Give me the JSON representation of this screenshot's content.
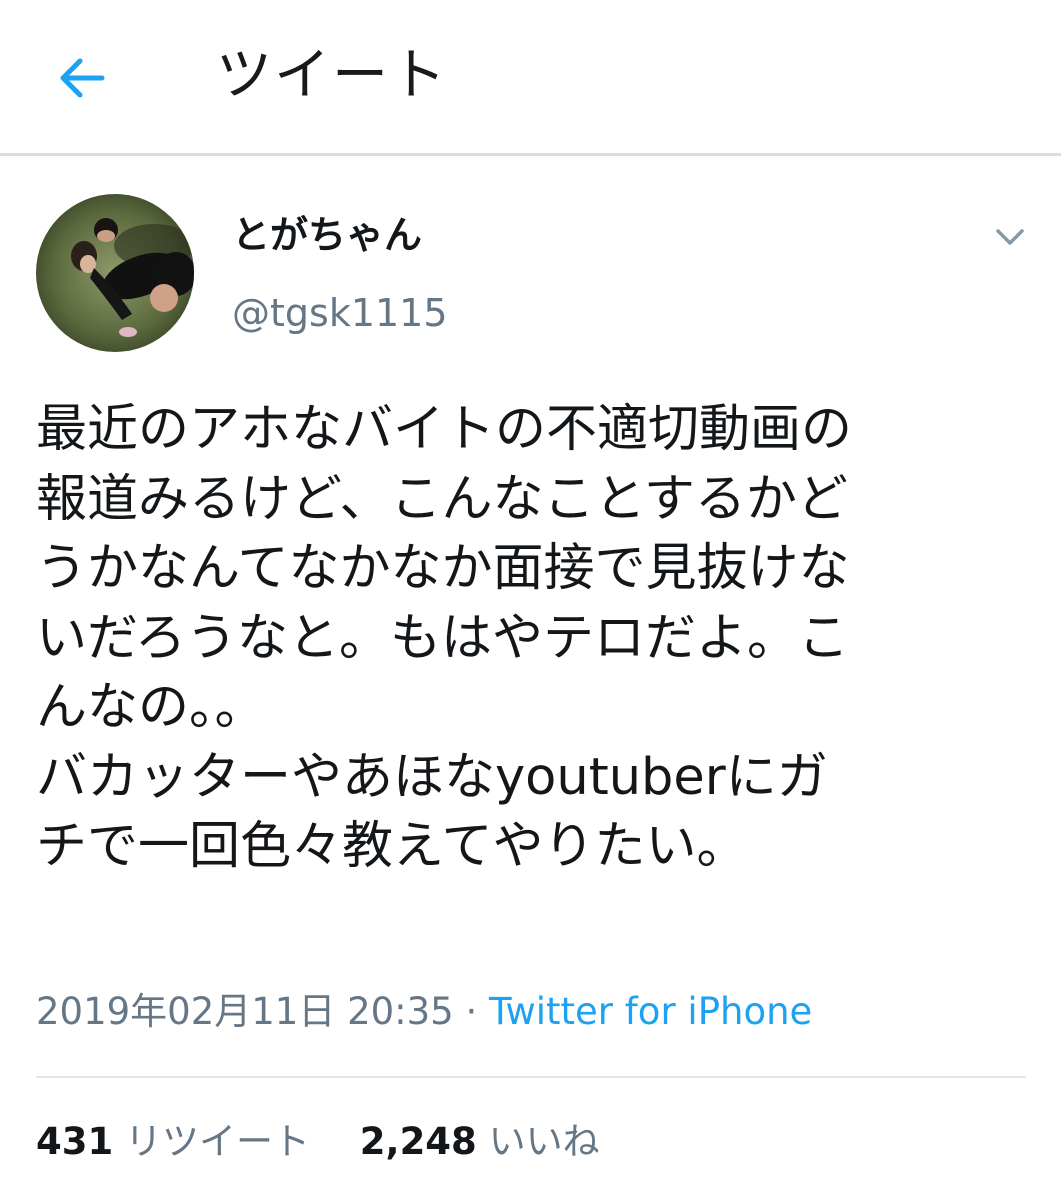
{
  "header": {
    "title": "ツイート",
    "back_icon": "arrow-left-icon"
  },
  "tweet": {
    "author": {
      "display_name": "とがちゃん",
      "handle": "@tgsk1115"
    },
    "text": "最近のアホなバイトの不適切動画の\n報道みるけど、こんなことするかど\nうかなんてなかなか面接で見抜けな\nいだろうなと。もはやテロだよ。こ\nんなの。。\nバカッターやあほなyoutuberにガ\nチで一回色々教えてやりたい。",
    "timestamp": "2019年02月11日 20:35",
    "separator": " · ",
    "source": "Twitter for iPhone",
    "retweets": {
      "count": "431",
      "label": "リツイート"
    },
    "likes": {
      "count": "2,248",
      "label": "いいね"
    }
  },
  "colors": {
    "accent": "#1da1f2",
    "secondary_text": "#657786",
    "primary_text": "#14171a"
  }
}
